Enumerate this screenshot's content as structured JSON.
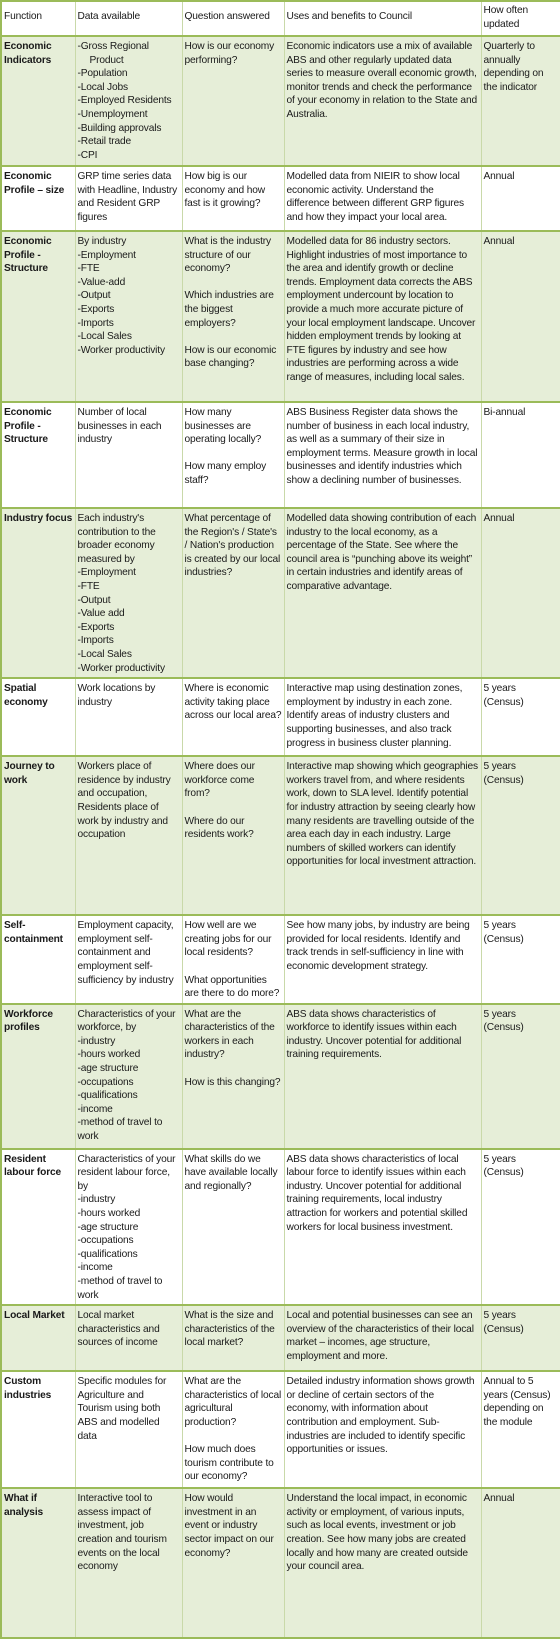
{
  "table": {
    "headers": [
      "Function",
      "Data available",
      "Question answered",
      "Uses and benefits to Council",
      "How often updated"
    ],
    "rows": [
      {
        "function": "Economic Indicators",
        "data_available": [
          "-Gross Regional",
          "Product",
          "-Population",
          "-Local Jobs",
          "-Employed Residents",
          "-Unemployment",
          "-Building approvals",
          "-Retail trade",
          "-CPI"
        ],
        "questions": [
          "How is our economy performing?"
        ],
        "uses": "Economic indicators use a mix of available ABS and other regularly updated data series to measure overall economic growth, monitor trends and check the performance of your economy in relation to the State and Australia.",
        "frequency": "Quarterly to annually depending on the indicator"
      },
      {
        "function": "Economic Profile – size",
        "data_available": [
          "GRP time series data with Headline, Industry and Resident GRP figures"
        ],
        "questions": [
          "How big is our economy and how fast is it growing?"
        ],
        "uses": "Modelled data from NIEIR to show local economic activity.  Understand the difference between different GRP figures and how they impact your local area.",
        "frequency": "Annual"
      },
      {
        "function": "Economic Profile - Structure",
        "data_available": [
          "By industry",
          "-Employment",
          "-FTE",
          "-Value-add",
          "-Output",
          "-Exports",
          "-Imports",
          "-Local Sales",
          "-Worker productivity"
        ],
        "questions": [
          "What is the industry structure of our economy?",
          "Which industries are the biggest employers?",
          "How is our economic base changing?"
        ],
        "uses": "Modelled data for 86 industry sectors. Highlight industries of most importance to the area and identify growth or decline trends. Employment data corrects the ABS employment undercount by location to provide a much more accurate picture of your local employment landscape. Uncover hidden employment trends by looking at FTE figures by industry and see how industries are performing across a wide range of measures, including local sales.",
        "frequency": "Annual"
      },
      {
        "function": "Economic Profile - Structure",
        "data_available": [
          "Number of local businesses in each industry"
        ],
        "questions": [
          "How many businesses are operating locally?",
          "How many employ staff?"
        ],
        "uses": "ABS Business Register data shows the number of business in each local industry, as well as a summary of their size in employment terms.  Measure growth in local businesses and identify industries which show a declining number of businesses.",
        "frequency": "Bi-annual"
      },
      {
        "function": "Industry focus",
        "data_available": [
          "Each industry's contribution to the broader economy measured by",
          "-Employment",
          "-FTE",
          "-Output",
          "-Value add",
          "-Exports",
          "-Imports",
          "-Local Sales",
          "-Worker productivity"
        ],
        "questions": [
          "What percentage of the Region's / State's / Nation's production is created by our local industries?"
        ],
        "uses": "Modelled data showing contribution of each industry to the local economy, as a percentage of the State.  See where the council area is “punching above its weight” in certain industries and identify areas of comparative advantage.",
        "frequency": "Annual"
      },
      {
        "function": "Spatial economy",
        "data_available": [
          "Work locations by industry"
        ],
        "questions": [
          "Where is economic activity taking place across our local area?"
        ],
        "uses": "Interactive map using destination zones, employment by industry in each zone. Identify areas of industry clusters and supporting businesses, and also track progress in business cluster planning.",
        "frequency": "5 years (Census)"
      },
      {
        "function": "Journey to work",
        "data_available": [
          "Workers place of residence by industry and occupation, Residents place of work by industry and occupation"
        ],
        "questions": [
          "Where does our workforce come from?",
          "Where do our residents work?"
        ],
        "uses": "Interactive map showing which geographies workers travel from, and where residents work, down to SLA level. Identify potential for industry attraction by seeing clearly how many residents are travelling outside of the area each day in each industry.  Large numbers of skilled workers can identify opportunities for local investment attraction.",
        "frequency": "5 years (Census)"
      },
      {
        "function": "Self-containment",
        "data_available": [
          "Employment capacity, employment self-containment and employment self-sufficiency by industry"
        ],
        "questions": [
          "How well are we creating jobs for our local residents?",
          "What opportunities are there to do more?"
        ],
        "uses": "See how many jobs, by industry are being provided for local residents.  Identify and track trends in self-sufficiency in line with economic development strategy.",
        "frequency": "5 years (Census)"
      },
      {
        "function": "Workforce profiles",
        "data_available": [
          "Characteristics of your workforce, by",
          "-industry",
          "-hours worked",
          "-age structure",
          "-occupations",
          "-qualifications",
          "-income",
          "-method of travel to work"
        ],
        "questions": [
          "What are the characteristics of the workers in each industry?",
          "How is this changing?"
        ],
        "uses": "ABS data shows characteristics of workforce to identify issues within each industry. Uncover potential for additional training requirements.",
        "frequency": "5 years (Census)"
      },
      {
        "function": "Resident labour force",
        "data_available": [
          "Characteristics of your resident labour force, by",
          "-industry",
          "-hours worked",
          "-age structure",
          "-occupations",
          "-qualifications",
          "-income",
          "-method of travel to work"
        ],
        "questions": [
          "What skills do we have available locally and regionally?"
        ],
        "uses": "ABS data shows characteristics of local labour force to identify issues within each industry. Uncover potential for additional training requirements, local industry attraction for workers and potential skilled workers for local business investment.",
        "frequency": "5 years (Census)"
      },
      {
        "function": "Local Market",
        "data_available": [
          "Local market characteristics and sources of income"
        ],
        "questions": [
          "What is the size and characteristics of the local market?"
        ],
        "uses": "Local and potential businesses can see an overview of the characteristics of their local market – incomes, age structure, employment and more.",
        "frequency": "5 years (Census)"
      },
      {
        "function": "Custom industries",
        "data_available": [
          "Specific modules for Agriculture and Tourism using both ABS and modelled data"
        ],
        "questions": [
          "What are the characteristics of local agricultural production?",
          "How much does tourism contribute to our economy?"
        ],
        "uses": "Detailed industry information shows growth or decline of certain sectors of the economy, with information about contribution and employment.  Sub-industries are included to identify specific opportunities or issues.",
        "frequency": "Annual to 5 years (Census) depending on the module"
      },
      {
        "function": "What if analysis",
        "data_available": [
          "Interactive tool to assess impact of investment, job creation and tourism events on the local economy"
        ],
        "questions": [
          "How would investment in an event or industry sector impact on our economy?"
        ],
        "uses": "Understand the local impact, in economic activity or employment, of various inputs, such as local events, investment or job creation.  See how many jobs are created locally and how many are created outside your council area.",
        "frequency": "Annual"
      }
    ]
  }
}
